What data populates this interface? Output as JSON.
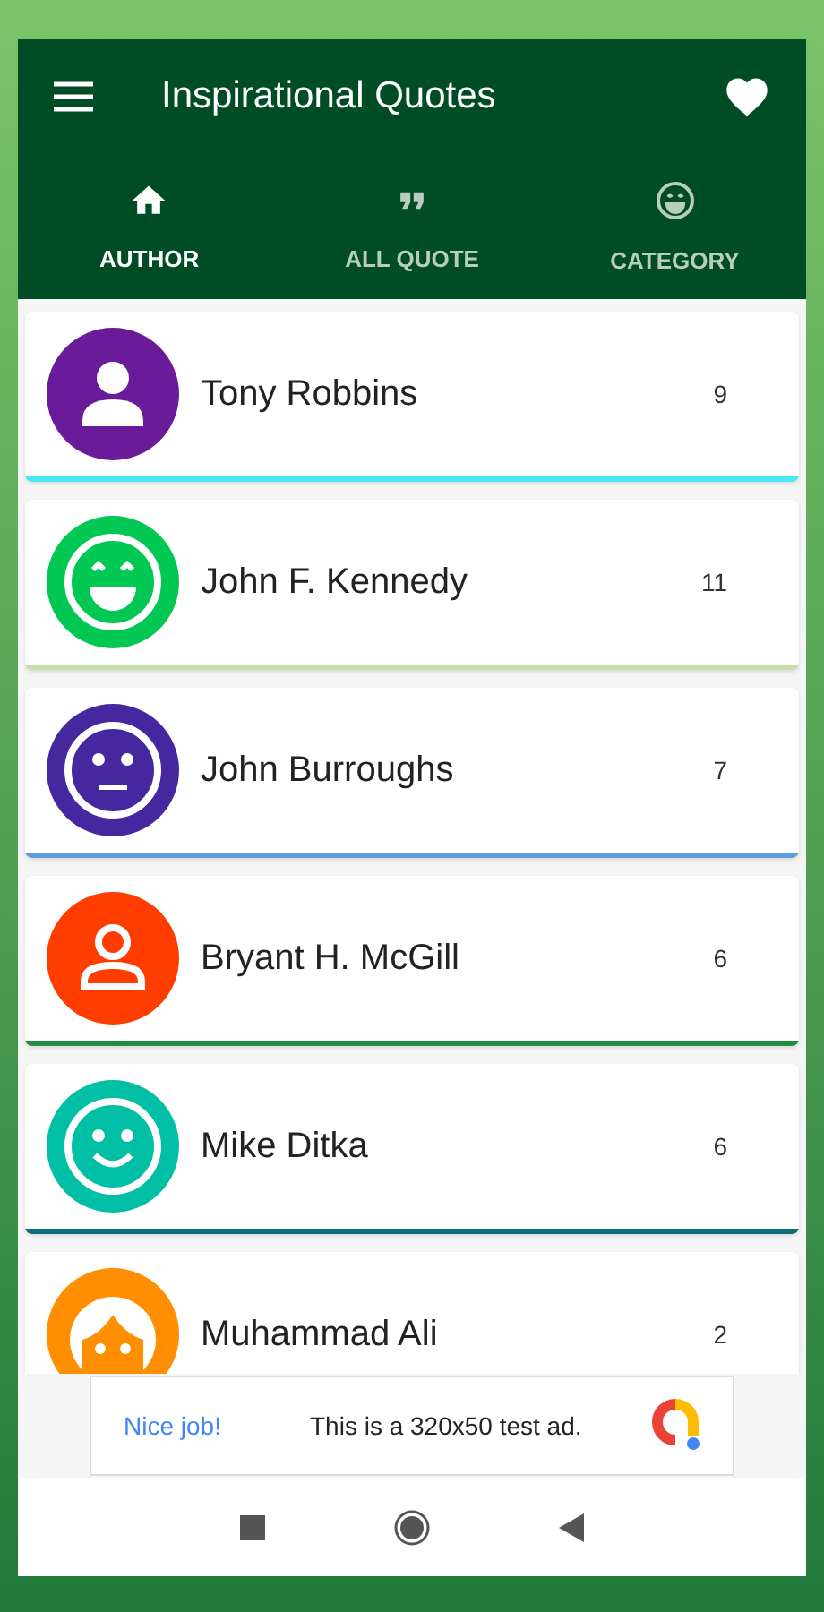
{
  "app_bar": {
    "title": "Inspirational Quotes"
  },
  "tabs": [
    {
      "label": "AUTHOR",
      "kind": "home",
      "selected": true
    },
    {
      "label": "ALL QUOTE",
      "kind": "quote",
      "selected": false
    },
    {
      "label": "CATEGORY",
      "kind": "smile",
      "selected": false
    }
  ],
  "authors": [
    {
      "name": "Tony Robbins",
      "count": "9",
      "avatar": {
        "kind": "person",
        "color": "#6a1b9a"
      },
      "stripe": {
        "color": "#4ae8f2"
      }
    },
    {
      "name": "John F. Kennedy",
      "count": "11",
      "avatar": {
        "kind": "grin",
        "color": "#00c853"
      },
      "stripe": {
        "color": "#c5e1a5"
      }
    },
    {
      "name": "John Burroughs",
      "count": "7",
      "avatar": {
        "kind": "neutral",
        "color": "#4527a0"
      },
      "stripe": {
        "color": "#5c9ddb"
      }
    },
    {
      "name": "Bryant H. McGill",
      "count": "6",
      "avatar": {
        "kind": "outline",
        "color": "#ff3d00"
      },
      "stripe": {
        "color": "#1e8e3e"
      }
    },
    {
      "name": "Mike Ditka",
      "count": "6",
      "avatar": {
        "kind": "smile",
        "color": "#00bfa5"
      },
      "stripe": {
        "color": "#0b6e7a"
      }
    },
    {
      "name": "Muhammad Ali",
      "count": "2",
      "avatar": {
        "kind": "face",
        "color": "#ff8f00"
      }
    }
  ],
  "ad": {
    "headline": "Nice job!",
    "text": "This is a 320x50 test ad."
  }
}
